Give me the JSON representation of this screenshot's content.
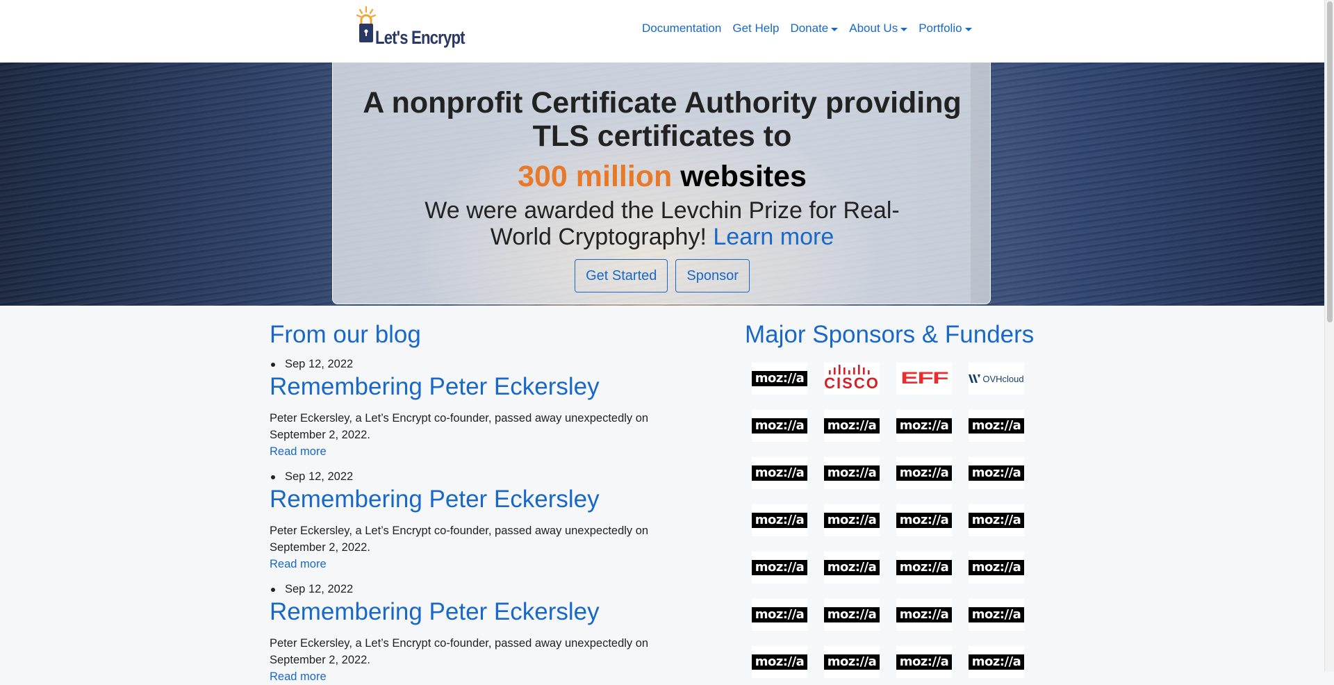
{
  "brand": {
    "name": "Let's Encrypt",
    "accent": "#1868c9",
    "orange": "#e67a2a",
    "navy": "#2a3866"
  },
  "nav": {
    "items": [
      {
        "label": "Documentation",
        "dropdown": false
      },
      {
        "label": "Get Help",
        "dropdown": false
      },
      {
        "label": "Donate",
        "dropdown": true
      },
      {
        "label": "About Us",
        "dropdown": true
      },
      {
        "label": "Portfolio",
        "dropdown": true
      }
    ]
  },
  "hero": {
    "title": "A nonprofit Certificate Authority providing TLS certificates to",
    "stat_number": "300 million",
    "stat_unit": "websites",
    "award_text": "We were awarded the Levchin Prize for Real-World Cryptography!",
    "award_link": "Learn more",
    "buttons": {
      "get_started": "Get Started",
      "sponsor": "Sponsor"
    }
  },
  "blog": {
    "heading": "From our blog",
    "posts": [
      {
        "date": "Sep 12, 2022",
        "title": "Remembering Peter Eckersley",
        "excerpt": "Peter Eckersley, a Let’s Encrypt co-founder, passed away unexpectedly on September 2, 2022.",
        "more": "Read more"
      },
      {
        "date": "Sep 12, 2022",
        "title": "Remembering Peter Eckersley",
        "excerpt": "Peter Eckersley, a Let’s Encrypt co-founder, passed away unexpectedly on September 2, 2022.",
        "more": "Read more"
      },
      {
        "date": "Sep 12, 2022",
        "title": "Remembering Peter Eckersley",
        "excerpt": "Peter Eckersley, a Let’s Encrypt co-founder, passed away unexpectedly on September 2, 2022.",
        "more": "Read more"
      }
    ]
  },
  "sponsors": {
    "heading": "Major Sponsors & Funders",
    "first_row": [
      {
        "name": "mozilla",
        "text": "moz://a"
      },
      {
        "name": "cisco",
        "text": "CISCO"
      },
      {
        "name": "eff",
        "text": "EFF"
      },
      {
        "name": "ovhcloud",
        "text": "OVHcloud"
      }
    ],
    "repeat_logo_text": "moz://a"
  }
}
